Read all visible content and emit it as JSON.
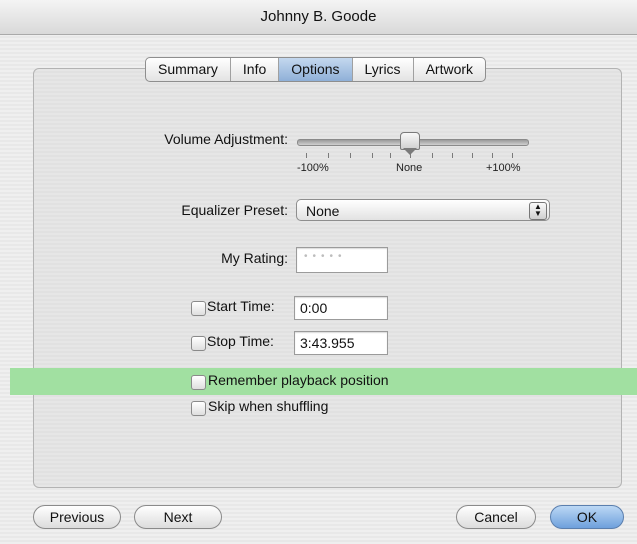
{
  "window": {
    "title": "Johnny B. Goode"
  },
  "tabs": [
    {
      "label": "Summary"
    },
    {
      "label": "Info"
    },
    {
      "label": "Options",
      "active": true
    },
    {
      "label": "Lyrics"
    },
    {
      "label": "Artwork"
    }
  ],
  "volume": {
    "label": "Volume Adjustment:",
    "min_label": "-100%",
    "mid_label": "None",
    "max_label": "+100%",
    "value_percent": 0
  },
  "equalizer": {
    "label": "Equalizer Preset:",
    "value": "None"
  },
  "rating": {
    "label": "My Rating:",
    "stars": 0
  },
  "start_time": {
    "label": "Start Time:",
    "value": "0:00",
    "checked": false
  },
  "stop_time": {
    "label": "Stop Time:",
    "value": "3:43.955",
    "checked": false
  },
  "remember_playback": {
    "label": "Remember playback position",
    "checked": false
  },
  "skip_shuffling": {
    "label": "Skip when shuffling",
    "checked": false
  },
  "buttons": {
    "previous": "Previous",
    "next": "Next",
    "cancel": "Cancel",
    "ok": "OK"
  },
  "colors": {
    "highlight": "#a1e0a1",
    "active_tab": "#8fb0d8",
    "default_button": "#6ea0dc"
  }
}
